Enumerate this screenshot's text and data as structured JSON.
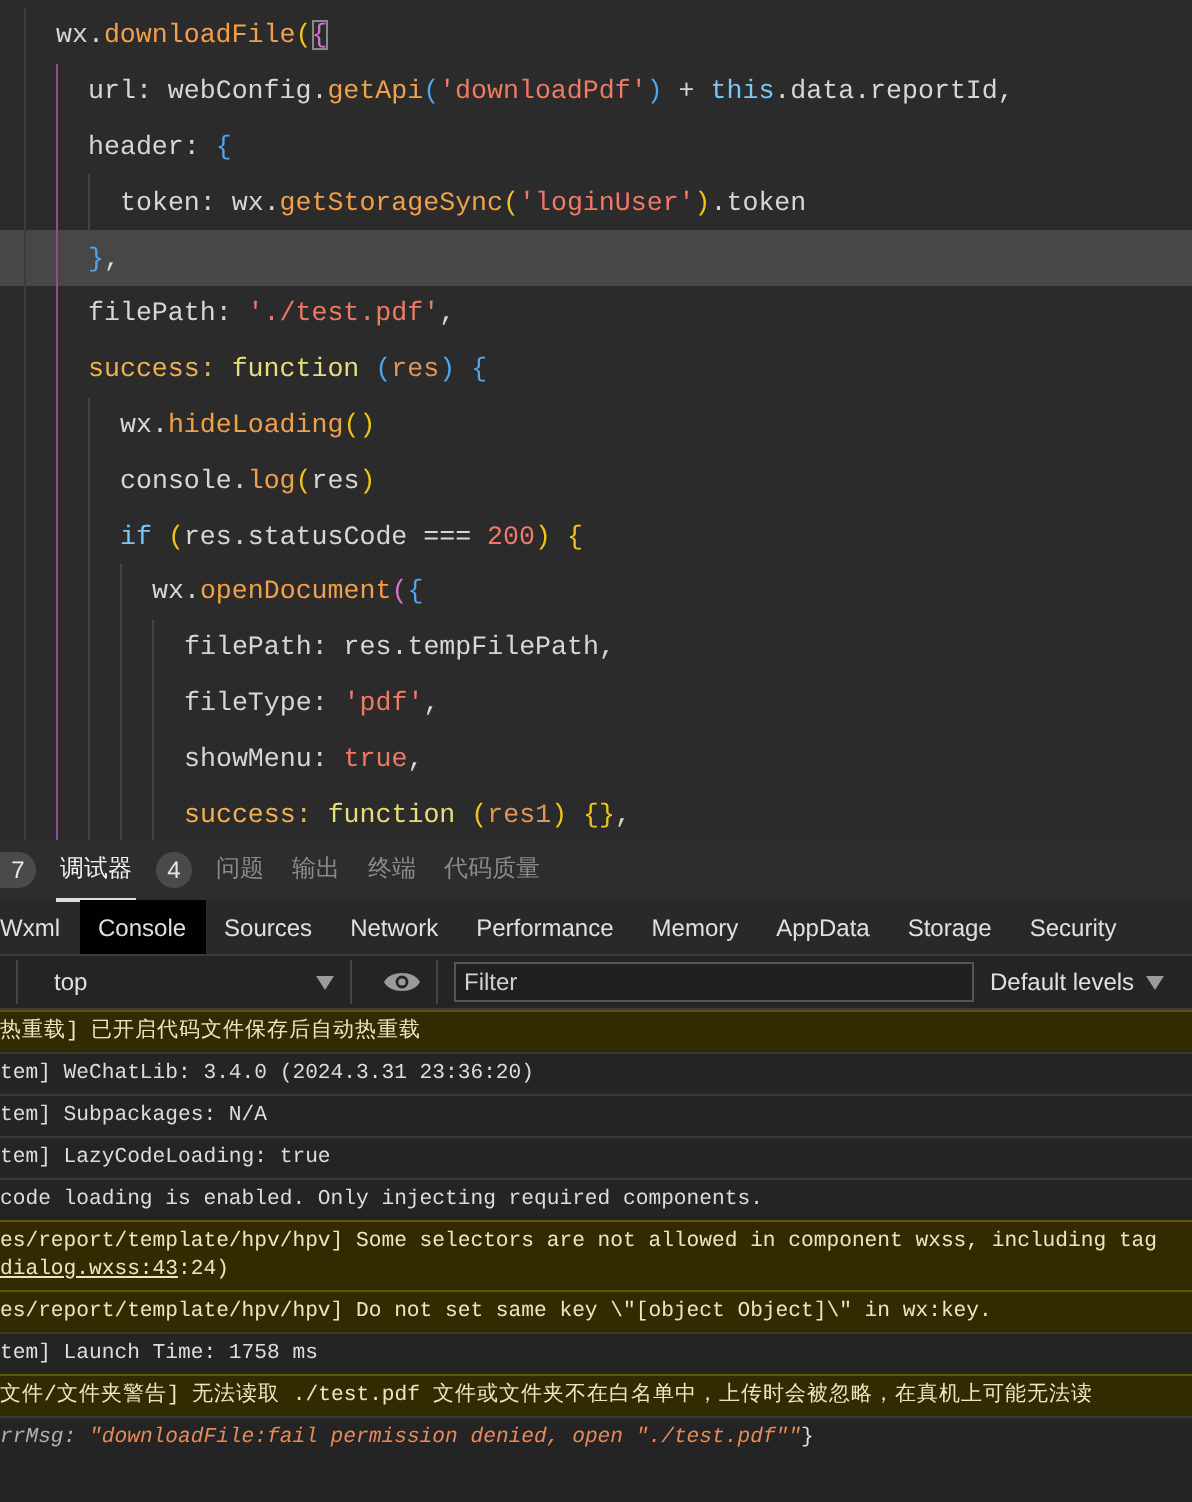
{
  "editor": {
    "lines": [
      {
        "highlighted": false,
        "tokens": [
          {
            "t": "wx.",
            "kind": "plain"
          },
          {
            "t": "downloadFile",
            "kind": "fn"
          },
          {
            "t": "(",
            "kind": "br1"
          },
          {
            "t": "{",
            "kind": "match"
          }
        ],
        "children": [
          {
            "highlighted": false,
            "tokens": [
              {
                "t": "url: webConfig.",
                "kind": "plain"
              },
              {
                "t": "getApi",
                "kind": "fn"
              },
              {
                "t": "(",
                "kind": "br3"
              },
              {
                "t": "'downloadPdf'",
                "kind": "str"
              },
              {
                "t": ")",
                "kind": "br3"
              },
              {
                "t": " + ",
                "kind": "plain"
              },
              {
                "t": "this",
                "kind": "kw"
              },
              {
                "t": ".data.reportId,",
                "kind": "plain"
              }
            ]
          },
          {
            "highlighted": false,
            "tokens": [
              {
                "t": "header: ",
                "kind": "plain"
              },
              {
                "t": "{",
                "kind": "br3"
              }
            ],
            "children": [
              {
                "highlighted": false,
                "tokens": [
                  {
                    "t": "token: wx.",
                    "kind": "plain"
                  },
                  {
                    "t": "getStorageSync",
                    "kind": "fn"
                  },
                  {
                    "t": "(",
                    "kind": "br1"
                  },
                  {
                    "t": "'loginUser'",
                    "kind": "str"
                  },
                  {
                    "t": ")",
                    "kind": "br1"
                  },
                  {
                    "t": ".token",
                    "kind": "plain"
                  }
                ]
              }
            ]
          },
          {
            "highlighted": true,
            "tokens": [
              {
                "t": "}",
                "kind": "br3"
              },
              {
                "t": ",",
                "kind": "plain"
              }
            ]
          },
          {
            "highlighted": false,
            "tokens": [
              {
                "t": "filePath: ",
                "kind": "plain"
              },
              {
                "t": "'./test.pdf'",
                "kind": "str"
              },
              {
                "t": ",",
                "kind": "plain"
              }
            ]
          },
          {
            "highlighted": false,
            "tokens": [
              {
                "t": "success: ",
                "kind": "key"
              },
              {
                "t": "function ",
                "kind": "fnkw"
              },
              {
                "t": "(",
                "kind": "br3"
              },
              {
                "t": "res",
                "kind": "param"
              },
              {
                "t": ") ",
                "kind": "br3"
              },
              {
                "t": "{",
                "kind": "br3"
              }
            ],
            "children": [
              {
                "highlighted": false,
                "tokens": [
                  {
                    "t": "wx.",
                    "kind": "plain"
                  },
                  {
                    "t": "hideLoading",
                    "kind": "fn"
                  },
                  {
                    "t": "()",
                    "kind": "br1"
                  }
                ]
              },
              {
                "highlighted": false,
                "tokens": [
                  {
                    "t": "console.",
                    "kind": "plain"
                  },
                  {
                    "t": "log",
                    "kind": "fn"
                  },
                  {
                    "t": "(",
                    "kind": "br1"
                  },
                  {
                    "t": "res",
                    "kind": "plain"
                  },
                  {
                    "t": ")",
                    "kind": "br1"
                  }
                ]
              },
              {
                "highlighted": false,
                "tokens": [
                  {
                    "t": "if ",
                    "kind": "kw"
                  },
                  {
                    "t": "(",
                    "kind": "br1"
                  },
                  {
                    "t": "res.statusCode === ",
                    "kind": "plain"
                  },
                  {
                    "t": "200",
                    "kind": "num"
                  },
                  {
                    "t": ") ",
                    "kind": "br1"
                  },
                  {
                    "t": "{",
                    "kind": "br1"
                  }
                ],
                "children": [
                  {
                    "highlighted": false,
                    "tokens": [
                      {
                        "t": "wx.",
                        "kind": "plain"
                      },
                      {
                        "t": "openDocument",
                        "kind": "fn"
                      },
                      {
                        "t": "(",
                        "kind": "br2"
                      },
                      {
                        "t": "{",
                        "kind": "br3"
                      }
                    ],
                    "children": [
                      {
                        "highlighted": false,
                        "tokens": [
                          {
                            "t": "filePath: res.tempFilePath,",
                            "kind": "plain"
                          }
                        ]
                      },
                      {
                        "highlighted": false,
                        "tokens": [
                          {
                            "t": "fileType: ",
                            "kind": "plain"
                          },
                          {
                            "t": "'pdf'",
                            "kind": "str"
                          },
                          {
                            "t": ",",
                            "kind": "plain"
                          }
                        ]
                      },
                      {
                        "highlighted": false,
                        "tokens": [
                          {
                            "t": "showMenu: ",
                            "kind": "plain"
                          },
                          {
                            "t": "true",
                            "kind": "num"
                          },
                          {
                            "t": ",",
                            "kind": "plain"
                          }
                        ]
                      },
                      {
                        "highlighted": false,
                        "tokens": [
                          {
                            "t": "success: ",
                            "kind": "key"
                          },
                          {
                            "t": "function ",
                            "kind": "fnkw"
                          },
                          {
                            "t": "(",
                            "kind": "br1"
                          },
                          {
                            "t": "res1",
                            "kind": "param"
                          },
                          {
                            "t": ") ",
                            "kind": "br1"
                          },
                          {
                            "t": "{}",
                            "kind": "br1"
                          },
                          {
                            "t": ",",
                            "kind": "plain"
                          }
                        ]
                      }
                    ]
                  }
                ]
              }
            ]
          }
        ]
      }
    ]
  },
  "leading_badge": "7",
  "panel_tabs": [
    {
      "label": "调试器",
      "selected": true,
      "badge": "4"
    },
    {
      "label": "问题",
      "selected": false
    },
    {
      "label": "输出",
      "selected": false
    },
    {
      "label": "终端",
      "selected": false
    },
    {
      "label": "代码质量",
      "selected": false
    }
  ],
  "devtools_tabs": [
    {
      "label": "Wxml",
      "selected": false
    },
    {
      "label": "Console",
      "selected": true
    },
    {
      "label": "Sources",
      "selected": false
    },
    {
      "label": "Network",
      "selected": false
    },
    {
      "label": "Performance",
      "selected": false
    },
    {
      "label": "Memory",
      "selected": false
    },
    {
      "label": "AppData",
      "selected": false
    },
    {
      "label": "Storage",
      "selected": false
    },
    {
      "label": "Security",
      "selected": false
    }
  ],
  "toolbar": {
    "context": "top",
    "filter_placeholder": "Filter",
    "levels": "Default levels"
  },
  "messages": [
    {
      "kind": "warn",
      "lines": [
        [
          {
            "t": "热重载] 已开启代码文件保存后自动热重载",
            "kind": "text"
          }
        ]
      ]
    },
    {
      "kind": "info",
      "lines": [
        [
          {
            "t": "tem] WeChatLib: 3.4.0 (2024.3.31 23:36:20)",
            "kind": "text"
          }
        ]
      ]
    },
    {
      "kind": "info",
      "lines": [
        [
          {
            "t": "tem] Subpackages: N/A",
            "kind": "text"
          }
        ]
      ]
    },
    {
      "kind": "info",
      "lines": [
        [
          {
            "t": "tem] LazyCodeLoading: true",
            "kind": "text"
          }
        ]
      ]
    },
    {
      "kind": "info",
      "lines": [
        [
          {
            "t": "code loading is enabled. Only injecting required components.",
            "kind": "text"
          }
        ]
      ]
    },
    {
      "kind": "warn",
      "lines": [
        [
          {
            "t": "es/report/template/hpv/hpv] Some selectors are not allowed in component wxss, including tag",
            "kind": "text"
          }
        ],
        [
          {
            "t": "dialog.wxss:43",
            "kind": "link"
          },
          {
            "t": ":24)",
            "kind": "text"
          }
        ]
      ]
    },
    {
      "kind": "warn",
      "lines": [
        [
          {
            "t": "es/report/template/hpv/hpv] Do not set same key \\\"[object Object]\\\" in wx:key.",
            "kind": "text"
          }
        ]
      ]
    },
    {
      "kind": "info",
      "lines": [
        [
          {
            "t": "tem] Launch Time: 1758 ms",
            "kind": "text"
          }
        ]
      ]
    },
    {
      "kind": "warn",
      "lines": [
        [
          {
            "t": "文件/文件夹警告] 无法读取 ./test.pdf 文件或文件夹不在白名单中，上传时会被忽略，在真机上可能无法读",
            "kind": "text"
          }
        ]
      ]
    },
    {
      "kind": "info",
      "lines": [
        [
          {
            "t": "rrMsg: ",
            "kind": "key"
          },
          {
            "t": "\"downloadFile:fail permission denied, open \"./test.pdf\"\"",
            "kind": "string"
          },
          {
            "t": "}",
            "kind": "text"
          }
        ]
      ]
    }
  ]
}
